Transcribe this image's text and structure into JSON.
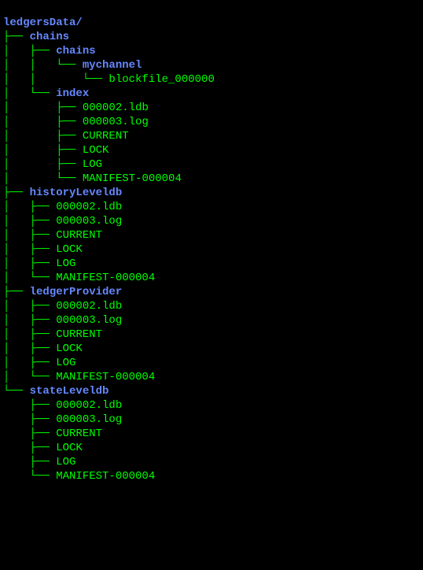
{
  "colors": {
    "background": "#000000",
    "directory": "#6688ff",
    "file": "#00ff00",
    "branch": "#00ff00"
  },
  "root": {
    "name": "ledgersData/",
    "type": "dir",
    "children": [
      {
        "name": "chains",
        "type": "dir",
        "children": [
          {
            "name": "chains",
            "type": "dir",
            "children": [
              {
                "name": "mychannel",
                "type": "dir",
                "children": [
                  {
                    "name": "blockfile_000000",
                    "type": "file"
                  }
                ]
              }
            ]
          },
          {
            "name": "index",
            "type": "dir",
            "children": [
              {
                "name": "000002.ldb",
                "type": "file"
              },
              {
                "name": "000003.log",
                "type": "file"
              },
              {
                "name": "CURRENT",
                "type": "file"
              },
              {
                "name": "LOCK",
                "type": "file"
              },
              {
                "name": "LOG",
                "type": "file"
              },
              {
                "name": "MANIFEST-000004",
                "type": "file"
              }
            ]
          }
        ]
      },
      {
        "name": "historyLeveldb",
        "type": "dir",
        "children": [
          {
            "name": "000002.ldb",
            "type": "file"
          },
          {
            "name": "000003.log",
            "type": "file"
          },
          {
            "name": "CURRENT",
            "type": "file"
          },
          {
            "name": "LOCK",
            "type": "file"
          },
          {
            "name": "LOG",
            "type": "file"
          },
          {
            "name": "MANIFEST-000004",
            "type": "file"
          }
        ]
      },
      {
        "name": "ledgerProvider",
        "type": "dir",
        "children": [
          {
            "name": "000002.ldb",
            "type": "file"
          },
          {
            "name": "000003.log",
            "type": "file"
          },
          {
            "name": "CURRENT",
            "type": "file"
          },
          {
            "name": "LOCK",
            "type": "file"
          },
          {
            "name": "LOG",
            "type": "file"
          },
          {
            "name": "MANIFEST-000004",
            "type": "file"
          }
        ]
      },
      {
        "name": "stateLeveldb",
        "type": "dir",
        "children": [
          {
            "name": "000002.ldb",
            "type": "file"
          },
          {
            "name": "000003.log",
            "type": "file"
          },
          {
            "name": "CURRENT",
            "type": "file"
          },
          {
            "name": "LOCK",
            "type": "file"
          },
          {
            "name": "LOG",
            "type": "file"
          },
          {
            "name": "MANIFEST-000004",
            "type": "file"
          }
        ]
      }
    ]
  }
}
